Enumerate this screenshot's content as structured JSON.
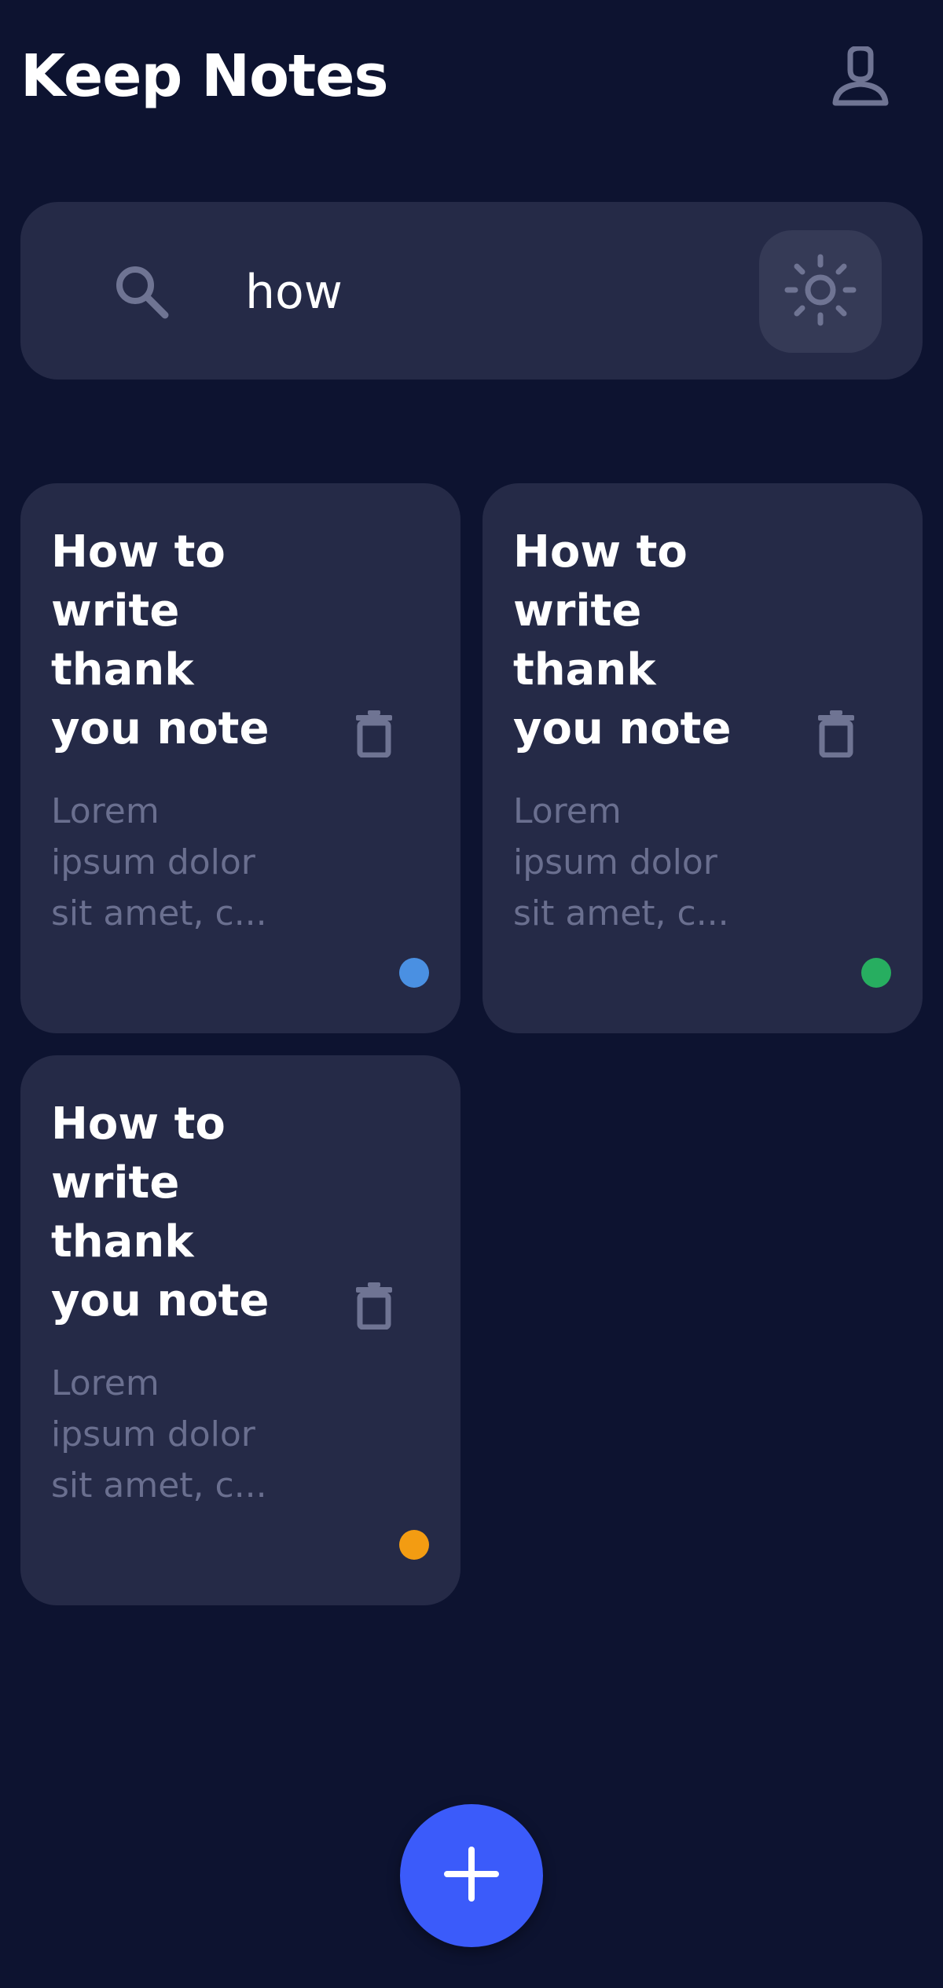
{
  "header": {
    "title": "Keep Notes",
    "profile_icon": "user-icon"
  },
  "search": {
    "value": "how",
    "icon": "search-icon",
    "theme_toggle_icon": "sun-icon"
  },
  "notes": [
    {
      "title": "How to write thank you note",
      "preview": "Lorem\nipsum dolor\nsit amet, c...",
      "color": "#4a90e2"
    },
    {
      "title": "How to write thank you note",
      "preview": "Lorem\nipsum dolor\nsit amet, c...",
      "color": "#27ae60"
    },
    {
      "title": "How to write thank you note",
      "preview": "Lorem\nipsum dolor\nsit amet, c...",
      "color": "#f39c12"
    }
  ],
  "fab": {
    "icon": "plus-icon"
  },
  "colors": {
    "background": "#0d1330",
    "surface": "#252a47",
    "accent": "#3b5bfa",
    "muted_text": "#6a6f8f"
  }
}
